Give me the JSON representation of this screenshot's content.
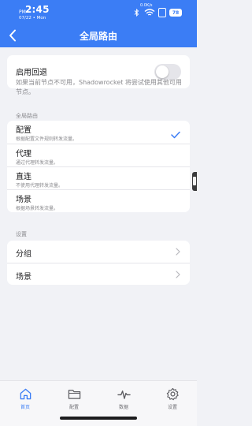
{
  "status_bar": {
    "ampm": "PM",
    "time": "2:45",
    "date": "07/22 • Mon",
    "net_speed": "0.0K/s",
    "sim_label": "",
    "battery": "78"
  },
  "nav": {
    "title": "全局路由"
  },
  "fallback": {
    "label": "启用回退",
    "enabled": false,
    "description": "如果当前节点不可用，Shadowrocket 将尝试使用其他可用节点。"
  },
  "global_routing": {
    "header": "全局路由",
    "options": [
      {
        "label": "配置",
        "sub": "根据配置文件规则转发流量。",
        "selected": true
      },
      {
        "label": "代理",
        "sub": "通过代理转发流量。",
        "selected": false
      },
      {
        "label": "直连",
        "sub": "不使用代理转发流量。",
        "selected": false
      },
      {
        "label": "场景",
        "sub": "根据场景转发流量。",
        "selected": false
      }
    ]
  },
  "settings": {
    "header": "设置",
    "items": [
      {
        "label": "分组"
      },
      {
        "label": "场景"
      }
    ]
  },
  "tab_bar": {
    "active_color": "#3b7df5",
    "tabs": [
      {
        "label": "首页",
        "icon": "house-icon",
        "active": true
      },
      {
        "label": "配置",
        "icon": "folder-icon",
        "active": false
      },
      {
        "label": "数据",
        "icon": "activity-icon",
        "active": false
      },
      {
        "label": "设置",
        "icon": "gear-icon",
        "active": false
      }
    ]
  },
  "colors": {
    "accent": "#3b7df5",
    "background": "#f1f2f6"
  }
}
